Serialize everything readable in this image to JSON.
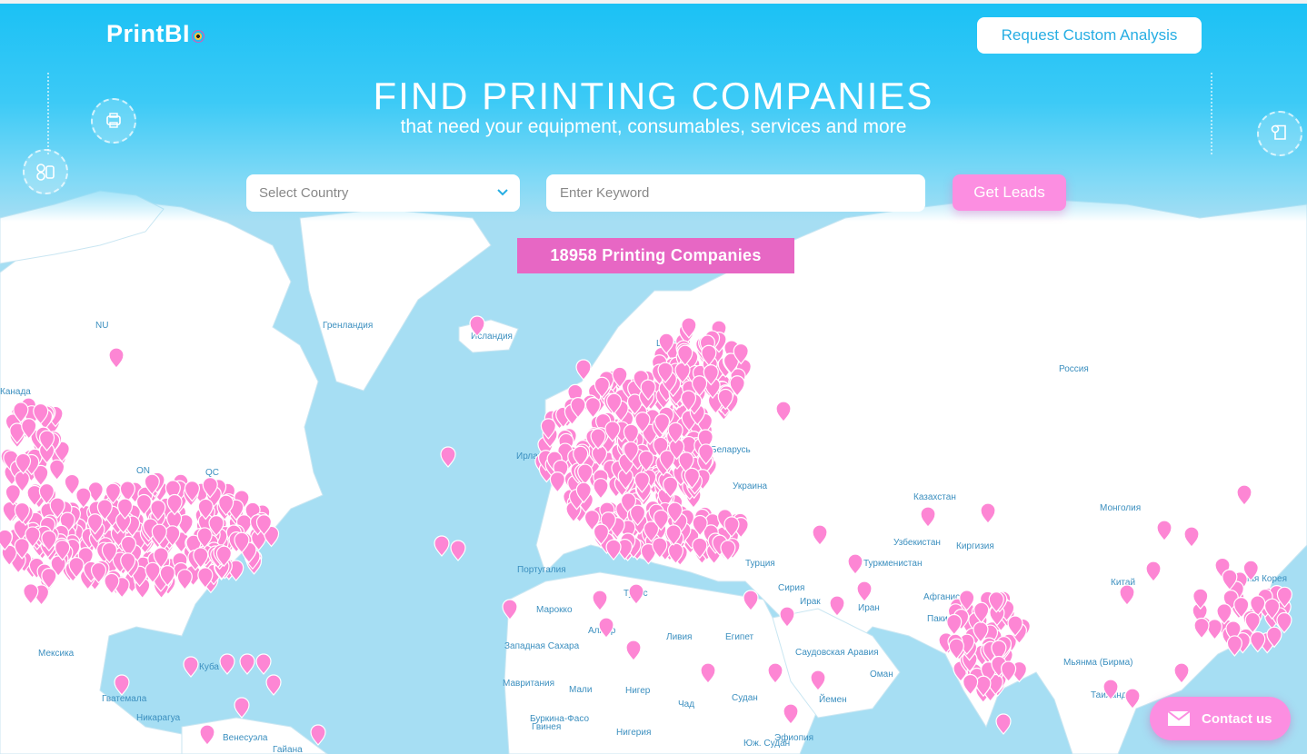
{
  "header": {
    "logo_text": "PrintBI",
    "request_button": "Request Custom Analysis"
  },
  "hero": {
    "title": "FIND PRINTING COMPANIES",
    "subtitle": "that need your equipment, consumables, services and more"
  },
  "search": {
    "country_placeholder": "Select Country",
    "keyword_placeholder": "Enter Keyword",
    "submit_label": "Get Leads"
  },
  "results": {
    "count_label": "18958 Printing Companies"
  },
  "contact": {
    "label": "Contact us"
  },
  "map": {
    "labels": [
      "Гренландия",
      "Исландия",
      "Швеция",
      "Россия",
      "Беларусь",
      "Украина",
      "Казахстан",
      "Монголия",
      "Узбекистан",
      "Киргизия",
      "Туркменистан",
      "Турция",
      "Сирия",
      "Ирак",
      "Иран",
      "Афганистан",
      "Пакистан",
      "Китай",
      "Южная Корея",
      "Португалия",
      "Марокко",
      "Тунис",
      "Алжир",
      "Ливия",
      "Египет",
      "Западная Сахара",
      "Мавритания",
      "Мали",
      "Нигер",
      "Чад",
      "Судан",
      "Саудовская Аравия",
      "Оман",
      "Йемен",
      "Эфиопия",
      "Юж. Судан",
      "Нигерия",
      "Буркина-Фасо",
      "Гвинея",
      "Мьянма (Бирма)",
      "Таиланд",
      "Венесуэла",
      "Гайана",
      "Никарагуа",
      "Гватемала",
      "Куба",
      "Мексика",
      "Канада",
      "ON",
      "QC",
      "NU",
      "Ирландия"
    ],
    "colors": {
      "water": "#a6def3",
      "land": "#ffffff",
      "pin": "#fd86d4",
      "accent": "#1bc1f5",
      "banner": "#e767c4"
    }
  }
}
